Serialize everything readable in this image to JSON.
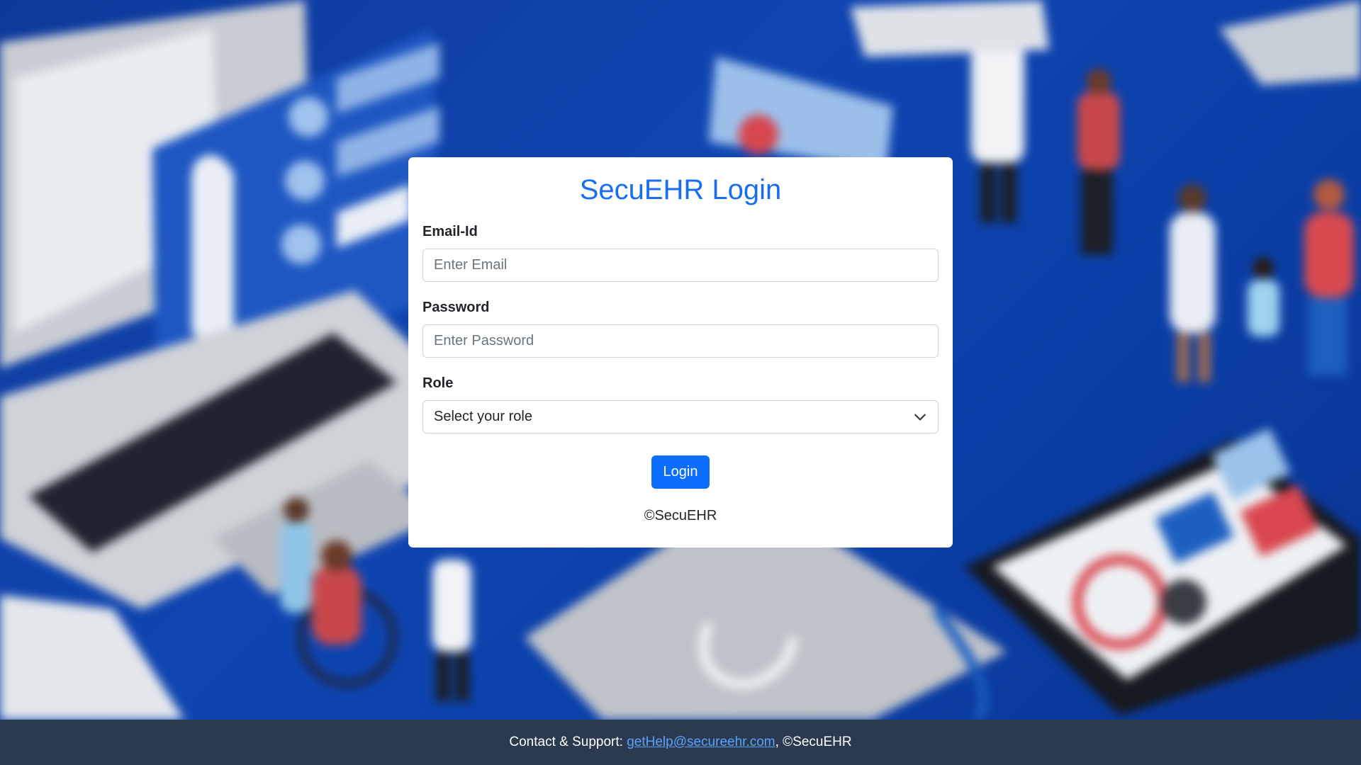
{
  "login": {
    "title": "SecuEHR Login",
    "email_label": "Email-Id",
    "email_placeholder": "Enter Email",
    "password_label": "Password",
    "password_placeholder": "Enter Password",
    "role_label": "Role",
    "role_selected": "Select your role",
    "login_button": "Login",
    "copyright": "©SecuEHR"
  },
  "footer": {
    "prefix": "Contact & Support: ",
    "email_link": "getHelp@secureehr.com",
    "suffix": ", ©SecuEHR"
  },
  "colors": {
    "accent": "#1a6df0",
    "button": "#0d6efd",
    "footer_bg": "#2c3a50",
    "background": "#0d3a9a"
  },
  "icons": {
    "role_dropdown": "chevron-down-icon"
  }
}
